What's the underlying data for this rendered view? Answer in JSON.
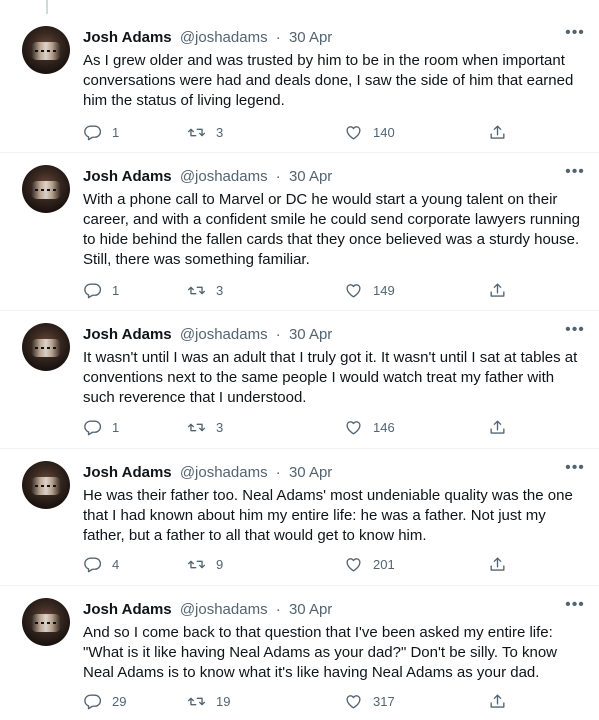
{
  "tweets": [
    {
      "name": "Josh Adams",
      "handle": "@joshadams",
      "separator": "·",
      "date": "30 Apr",
      "text": "As I grew older and was trusted by him to be in the room when important conversations were had and deals done, I saw the side of him that earned him the status of living legend.",
      "replies": "1",
      "retweets": "3",
      "likes": "140"
    },
    {
      "name": "Josh Adams",
      "handle": "@joshadams",
      "separator": "·",
      "date": "30 Apr",
      "text": "With a phone call to Marvel or DC he would start a young talent on their career, and with a confident smile he could send corporate lawyers running to hide behind the fallen cards that they once believed was a sturdy house. Still, there was something familiar.",
      "replies": "1",
      "retweets": "3",
      "likes": "149"
    },
    {
      "name": "Josh Adams",
      "handle": "@joshadams",
      "separator": "·",
      "date": "30 Apr",
      "text": "It wasn't until I was an adult that I truly got it. It wasn't until I sat at tables at conventions next to the same people I would watch treat my father with such reverence that I understood.",
      "replies": "1",
      "retweets": "3",
      "likes": "146"
    },
    {
      "name": "Josh Adams",
      "handle": "@joshadams",
      "separator": "·",
      "date": "30 Apr",
      "text": "He was their father too. Neal Adams' most undeniable quality was the one that I had known about him my entire life: he was a father. Not just my father, but a father to all that would get to know him.",
      "replies": "4",
      "retweets": "9",
      "likes": "201"
    },
    {
      "name": "Josh Adams",
      "handle": "@joshadams",
      "separator": "·",
      "date": "30 Apr",
      "text": "And so I come back to that question that I've been asked my entire life: \"What is it like having Neal Adams as your dad?\" Don't be silly. To know Neal Adams is to know what it's like having Neal Adams as your dad.",
      "replies": "29",
      "retweets": "19",
      "likes": "317"
    }
  ],
  "icons": {
    "reply": "reply-icon",
    "retweet": "retweet-icon",
    "like": "like-icon",
    "share": "share-icon",
    "more": "more-icon"
  },
  "colors": {
    "text": "#0f1419",
    "secondary": "#536471",
    "divider": "#eff3f4"
  }
}
